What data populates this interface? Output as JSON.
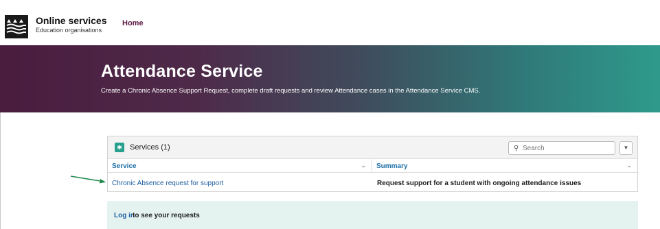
{
  "brand": {
    "title": "Online services",
    "subtitle": "Education organisations",
    "logo_icon": "waves-logo-icon"
  },
  "nav": {
    "home_label": "Home"
  },
  "hero": {
    "title": "Attendance Service",
    "description": "Create a Chronic Absence Support Request, complete draft requests and review Attendance cases in the Attendance Service CMS."
  },
  "services": {
    "title": "Services (1)",
    "search_placeholder": "Search",
    "columns": [
      "Service",
      "Summary"
    ],
    "rows": [
      {
        "service": "Chronic Absence request for support",
        "summary": "Request support for a student with ongoing attendance issues"
      }
    ]
  },
  "login": {
    "link_label": "Log in",
    "text": " to see your requests"
  },
  "colors": {
    "accent": "#5b1840",
    "teal": "#28a08e",
    "link": "#1d5fa0",
    "arrow": "#1e8a4c"
  }
}
